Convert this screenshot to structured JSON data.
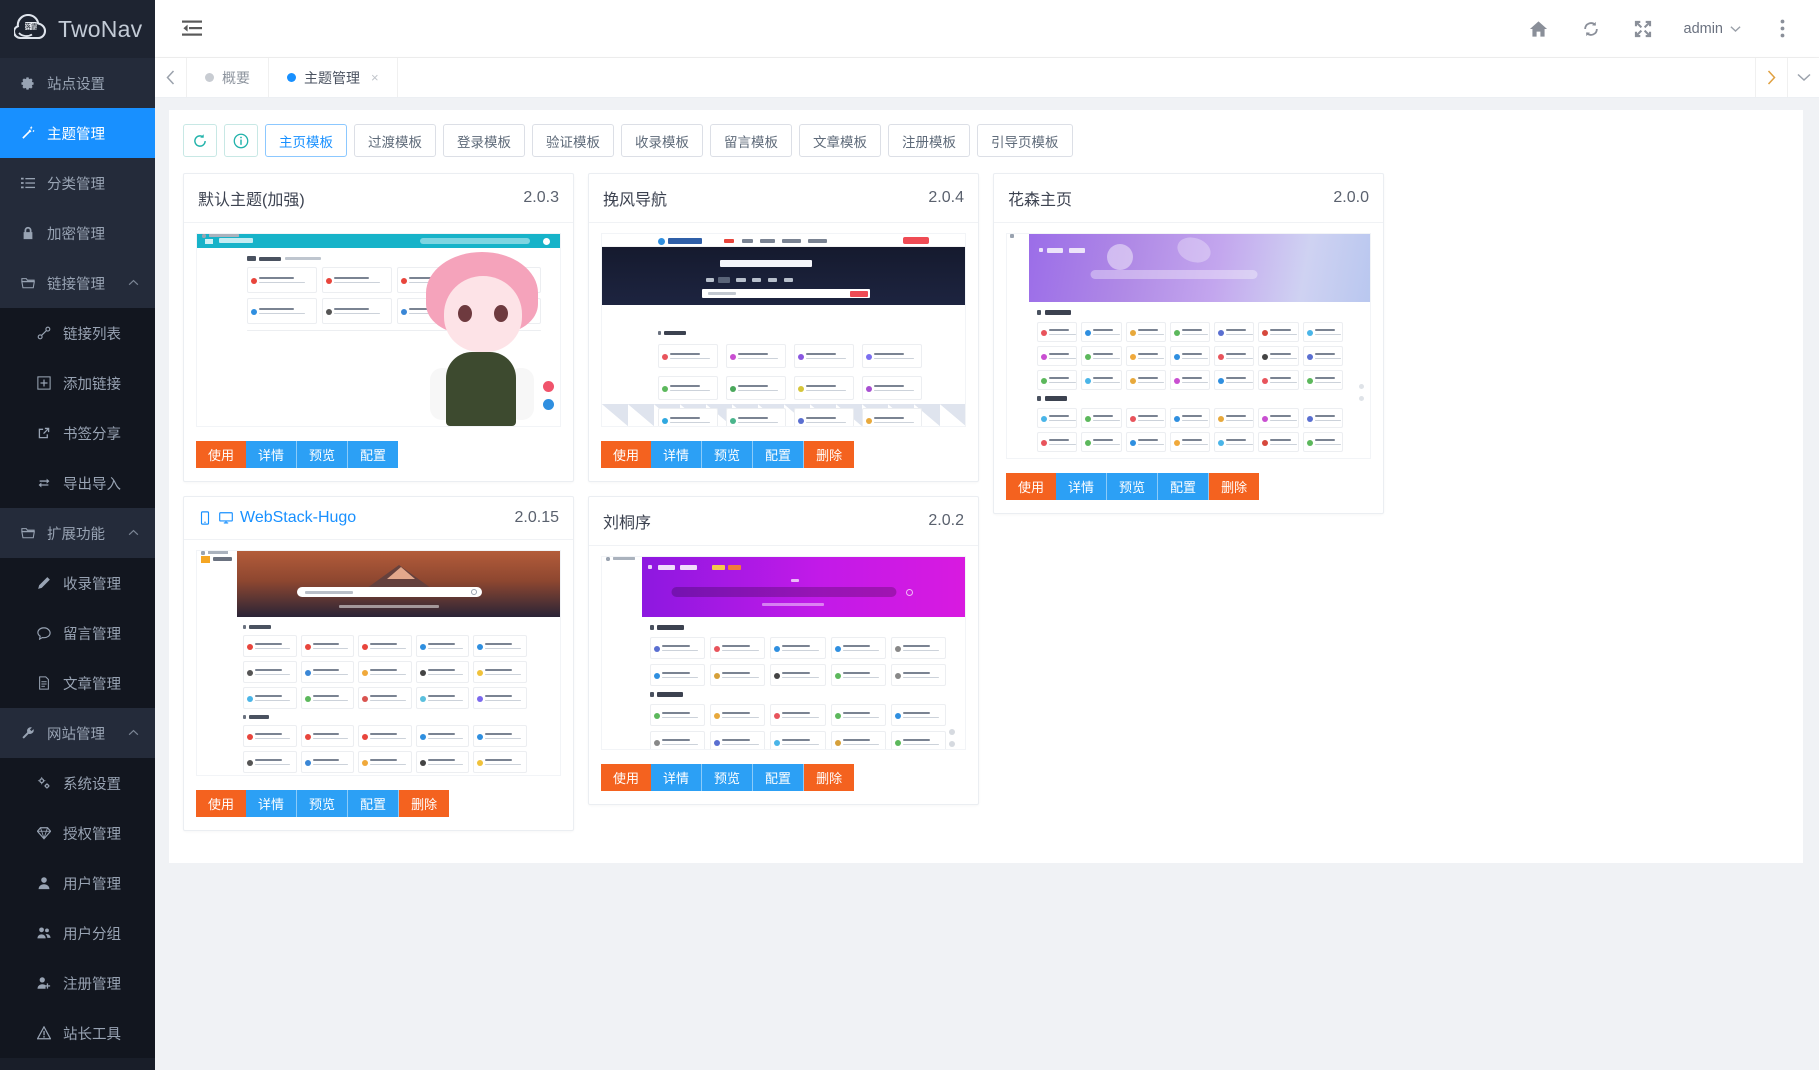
{
  "brand": {
    "name": "TwoNav",
    "logo_icon": "cloud-logo-icon"
  },
  "sidebar": {
    "items": [
      {
        "label": "站点设置",
        "icon": "gear-icon",
        "level": "top",
        "state": "normal"
      },
      {
        "label": "主题管理",
        "icon": "magic-wand-icon",
        "level": "top",
        "state": "active"
      },
      {
        "label": "分类管理",
        "icon": "list-icon",
        "level": "top",
        "state": "normal"
      },
      {
        "label": "加密管理",
        "icon": "lock-icon",
        "level": "top",
        "state": "normal"
      },
      {
        "label": "链接管理",
        "icon": "folder-icon",
        "level": "group",
        "state": "expanded"
      },
      {
        "label": "链接列表",
        "icon": "link-icon",
        "level": "sub",
        "state": "normal"
      },
      {
        "label": "添加链接",
        "icon": "plus-square-icon",
        "level": "sub",
        "state": "normal"
      },
      {
        "label": "书签分享",
        "icon": "external-link-icon",
        "level": "sub",
        "state": "normal"
      },
      {
        "label": "导出导入",
        "icon": "exchange-icon",
        "level": "sub",
        "state": "normal"
      },
      {
        "label": "扩展功能",
        "icon": "folder-icon",
        "level": "group",
        "state": "expanded"
      },
      {
        "label": "收录管理",
        "icon": "pencil-icon",
        "level": "sub",
        "state": "normal"
      },
      {
        "label": "留言管理",
        "icon": "comment-icon",
        "level": "sub",
        "state": "normal"
      },
      {
        "label": "文章管理",
        "icon": "file-text-icon",
        "level": "sub",
        "state": "normal"
      },
      {
        "label": "网站管理",
        "icon": "wrench-icon",
        "level": "group",
        "state": "expanded"
      },
      {
        "label": "系统设置",
        "icon": "cogs-icon",
        "level": "sub",
        "state": "normal"
      },
      {
        "label": "授权管理",
        "icon": "diamond-icon",
        "level": "sub",
        "state": "normal"
      },
      {
        "label": "用户管理",
        "icon": "user-icon",
        "level": "sub",
        "state": "normal"
      },
      {
        "label": "用户分组",
        "icon": "users-icon",
        "level": "sub",
        "state": "normal"
      },
      {
        "label": "注册管理",
        "icon": "user-plus-icon",
        "level": "sub",
        "state": "normal"
      },
      {
        "label": "站长工具",
        "icon": "warning-triangle-icon",
        "level": "sub",
        "state": "normal"
      }
    ],
    "caret_icon": "chevron-up-icon"
  },
  "header": {
    "collapse_icon": "menu-fold-icon",
    "icons": [
      {
        "name": "home-icon",
        "glyph": "⌂"
      },
      {
        "name": "refresh-icon",
        "glyph": "⟳"
      },
      {
        "name": "fullscreen-icon",
        "glyph": "⤢"
      }
    ],
    "user": "admin",
    "user_caret_icon": "chevron-down-icon",
    "more_icon": "ellipsis-vertical-icon"
  },
  "tabbar": {
    "left_arrow_icon": "chevron-left-icon",
    "right_arrow_icon": "chevron-right-icon",
    "dropdown_icon": "chevron-down-icon",
    "tabs": [
      {
        "label": "概要",
        "active": false,
        "closable": false
      },
      {
        "label": "主题管理",
        "active": true,
        "closable": true,
        "close_icon": "close-icon"
      }
    ]
  },
  "toolbar": {
    "refresh_icon": "refresh-icon",
    "info_icon": "info-circle-icon",
    "filters": [
      {
        "label": "主页模板",
        "active": true
      },
      {
        "label": "过渡模板",
        "active": false
      },
      {
        "label": "登录模板",
        "active": false
      },
      {
        "label": "验证模板",
        "active": false
      },
      {
        "label": "收录模板",
        "active": false
      },
      {
        "label": "留言模板",
        "active": false
      },
      {
        "label": "文章模板",
        "active": false
      },
      {
        "label": "注册模板",
        "active": false
      },
      {
        "label": "引导页模板",
        "active": false
      }
    ]
  },
  "actions": {
    "use": "使用",
    "detail": "详情",
    "preview": "预览",
    "config": "配置",
    "delete": "删除"
  },
  "themes": [
    {
      "name": "默认主题(加强)",
      "version": "2.0.3",
      "is_link": false,
      "icons": [],
      "thumb": "default-theme-thumbnail",
      "buttons": [
        "使用",
        "详情",
        "预览",
        "配置"
      ]
    },
    {
      "name": "WebStack-Hugo",
      "version": "2.0.15",
      "is_link": true,
      "icons": [
        "mobile-icon",
        "desktop-icon"
      ],
      "thumb": "webstack-hugo-thumbnail",
      "buttons": [
        "使用",
        "详情",
        "预览",
        "配置",
        "删除"
      ]
    },
    {
      "name": "挽风导航",
      "version": "2.0.4",
      "is_link": false,
      "icons": [],
      "thumb": "wanfeng-nav-thumbnail",
      "buttons": [
        "使用",
        "详情",
        "预览",
        "配置",
        "删除"
      ]
    },
    {
      "name": "刘桐序",
      "version": "2.0.2",
      "is_link": false,
      "icons": [],
      "thumb": "liutongxu-thumbnail",
      "buttons": [
        "使用",
        "详情",
        "预览",
        "配置",
        "删除"
      ]
    },
    {
      "name": "花森主页",
      "version": "2.0.0",
      "is_link": false,
      "icons": [],
      "thumb": "huasen-homepage-thumbnail",
      "buttons": [
        "使用",
        "详情",
        "预览",
        "配置",
        "删除"
      ]
    }
  ],
  "colors": {
    "sidebar_bg": "#191e29",
    "sidebar_sub_bg": "#12161f",
    "accent_blue": "#1890ff",
    "action_blue": "#2ca0f5",
    "action_orange": "#f4621f",
    "teal": "#20b2aa"
  }
}
